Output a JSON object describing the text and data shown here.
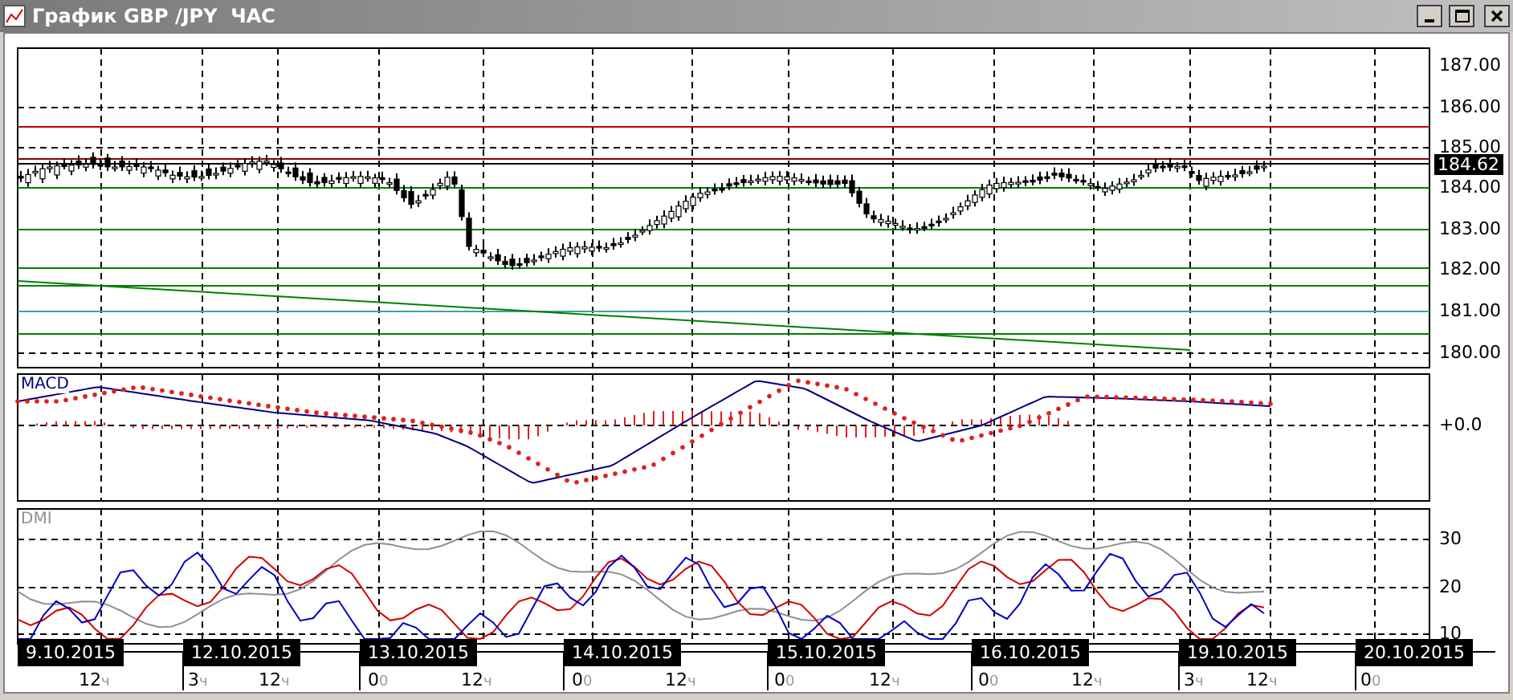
{
  "window": {
    "title": "График GBP /JPY  ЧАС"
  },
  "price_panel": {
    "axis_labels": [
      "187.00",
      "186.00",
      "185.00",
      "184.00",
      "183.00",
      "182.00",
      "181.00",
      "180.00"
    ],
    "last_price": "184.62"
  },
  "macd_panel": {
    "title": "MACD",
    "axis_labels": [
      "+0.0"
    ]
  },
  "dmi_panel": {
    "title": "DMI",
    "axis_labels": [
      "30",
      "20",
      "10"
    ]
  },
  "time_axis": {
    "dates": [
      "9.10.2015",
      "12.10.2015",
      "13.10.2015",
      "14.10.2015",
      "15.10.2015",
      "16.10.2015",
      "19.10.2015",
      "20.10.2015"
    ],
    "hours": [
      {
        "value": "12",
        "unit": "ч"
      },
      {
        "value": "3",
        "unit": "ч"
      },
      {
        "value": "12",
        "unit": "ч"
      },
      {
        "value": "0",
        "unit": "0"
      },
      {
        "value": "12",
        "unit": "ч"
      },
      {
        "value": "0",
        "unit": "0"
      },
      {
        "value": "12",
        "unit": "ч"
      },
      {
        "value": "0",
        "unit": "0"
      },
      {
        "value": "12",
        "unit": "ч"
      },
      {
        "value": "0",
        "unit": "0"
      },
      {
        "value": "12",
        "unit": "ч"
      },
      {
        "value": "3",
        "unit": "ч"
      },
      {
        "value": "12",
        "unit": "ч"
      },
      {
        "value": "0",
        "unit": "0"
      }
    ]
  }
}
